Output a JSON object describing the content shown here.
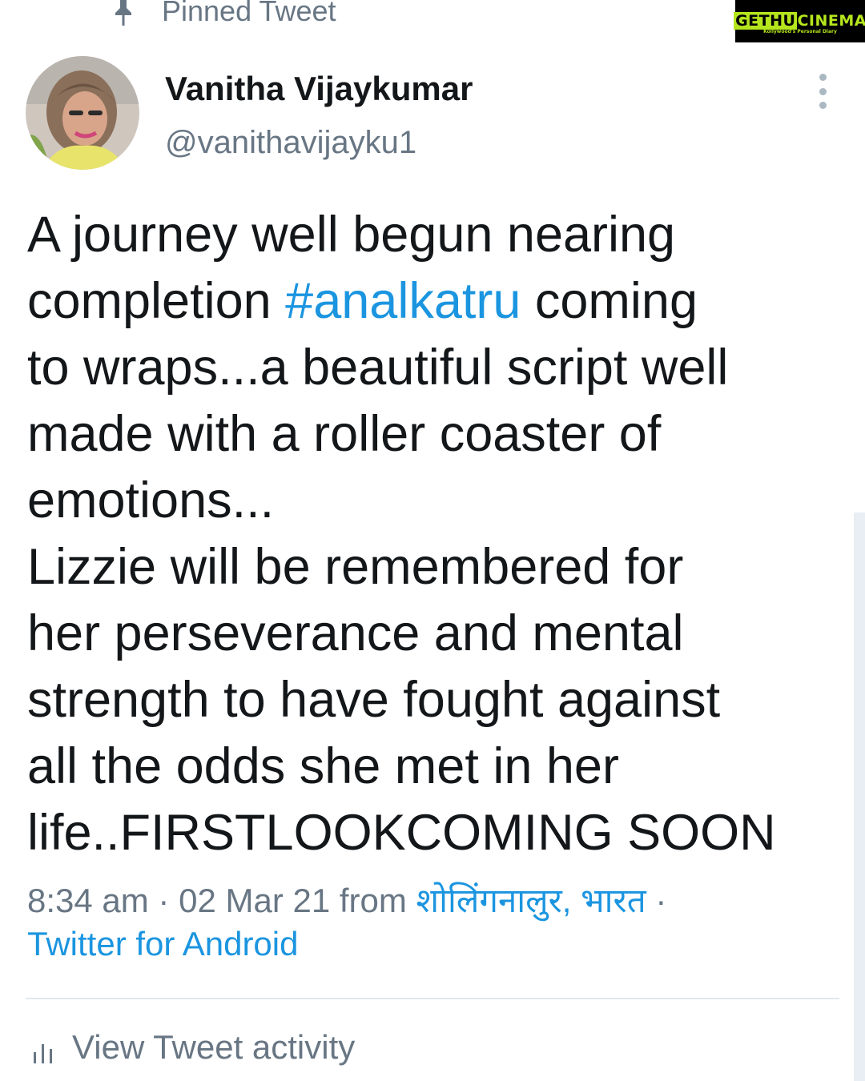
{
  "pinned": {
    "label": "Pinned Tweet",
    "icon": "pin-icon"
  },
  "watermark": {
    "title_a": "GETHU",
    "title_b": "CINEMA",
    "subtitle": "Kollywood's Personal Diary",
    "accent_color": "#b5e61d"
  },
  "author": {
    "name": "Vanitha Vijaykumar",
    "handle": "@vanithavijayku1"
  },
  "tweet": {
    "lines": {
      "l1": "A journey well begun nearing",
      "l2_pre": "completion ",
      "l2_hashtag": "#analkatru",
      "l2_post": " coming",
      "l3": "to wraps...a beautiful script well",
      "l4": "made with a roller coaster of",
      "l5": "emotions...",
      "l6": "Lizzie will be remembered for",
      "l7": "her perseverance and mental",
      "l8": "strength to have fought against",
      "l9": "all the odds she met in her",
      "l10": "life..FIRSTLOOKCOMING SOON"
    }
  },
  "meta": {
    "time_date": "8:34 am · 02 Mar 21 from ",
    "location": "शोलिंगनालुर, भारत",
    "separator": " ·",
    "source": "Twitter for Android"
  },
  "activity": {
    "label": "View Tweet activity",
    "icon": "bar-chart-icon"
  },
  "colors": {
    "link": "#1b95e0",
    "secondary_text": "#687684",
    "primary_text": "#14171a",
    "divider": "#e1e8ed"
  }
}
